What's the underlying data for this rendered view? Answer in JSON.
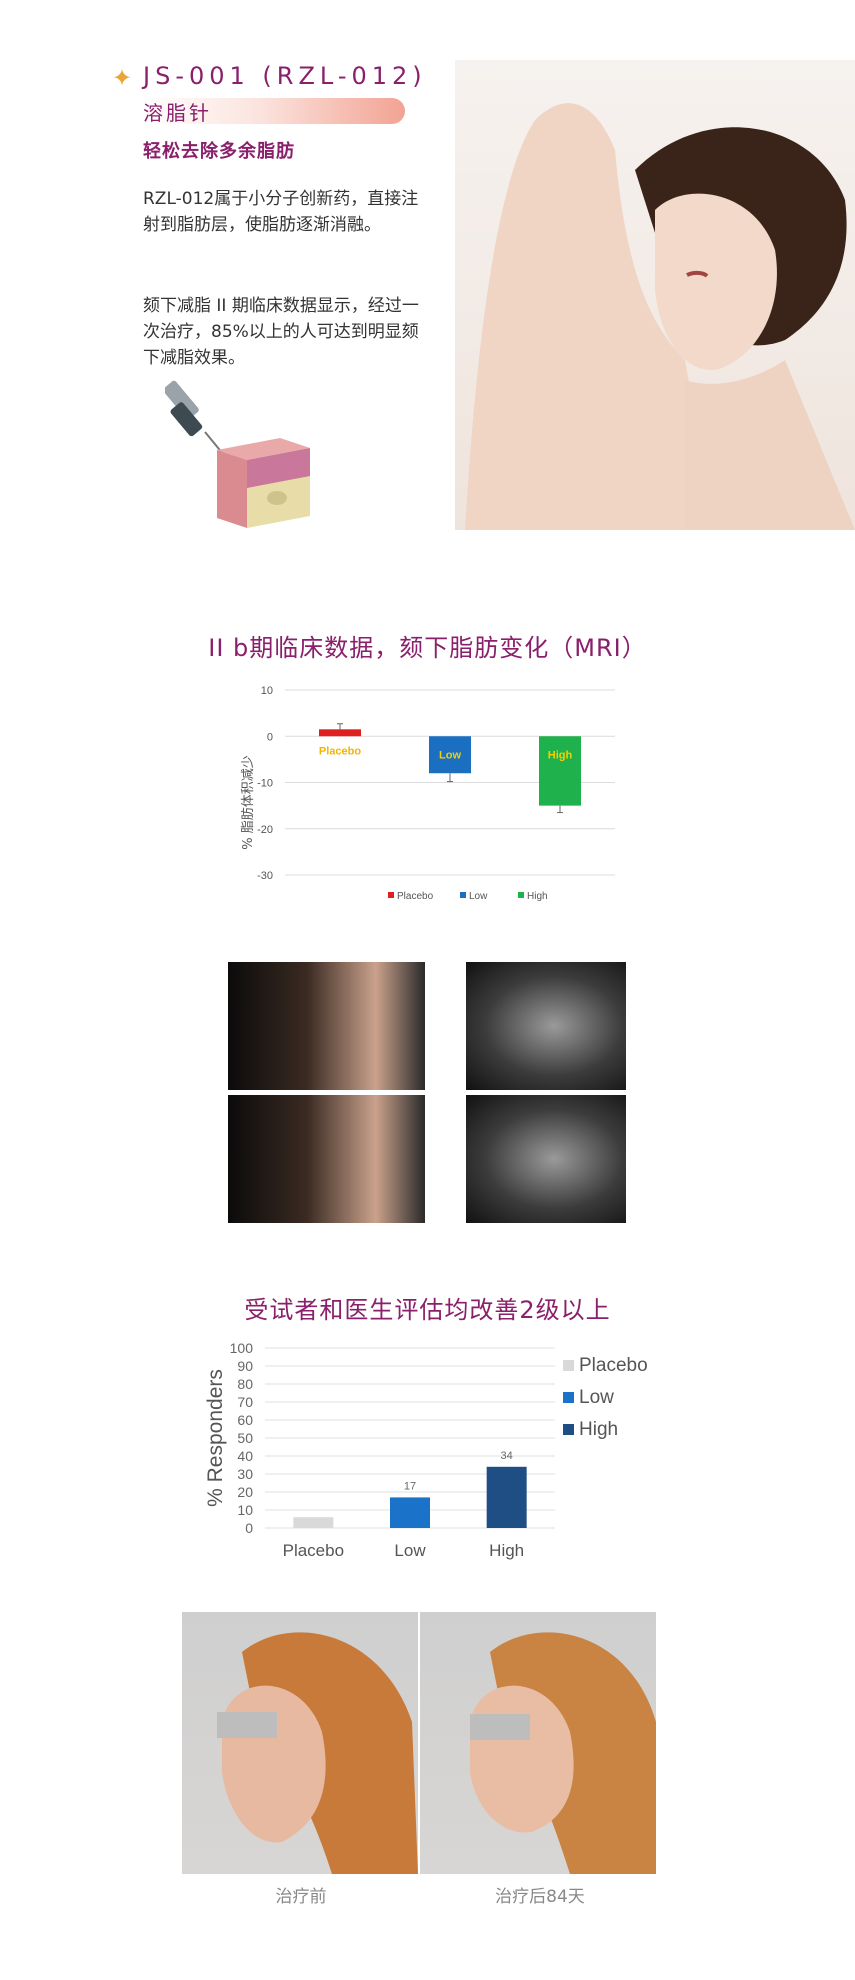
{
  "hero": {
    "star_glyph": "✦",
    "product_code": "JS-001 (RZL-012)",
    "product_name": "溶脂针",
    "subtitle": "轻松去除多余脂肪",
    "paragraph_1": "RZL-012属于小分子创新药，直接注射到脂肪层，使脂肪逐渐消融。",
    "paragraph_2": "颏下减脂 II 期临床数据显示，经过一次治疗，85%以上的人可达到明显颏下减脂效果。",
    "accent_color": "#8a1f6b",
    "star_color": "#e9a43a"
  },
  "mri_section": {
    "title": "II b期临床数据，颏下脂肪变化（MRI）"
  },
  "responders_section": {
    "title": "受试者和医生评估均改善2级以上"
  },
  "before_after": {
    "before_caption": "治疗前",
    "after_caption": "治疗后84天"
  },
  "chart_data": [
    {
      "type": "bar",
      "categories": [
        "Placebo",
        "Low",
        "High"
      ],
      "values": [
        1.5,
        -8,
        -15
      ],
      "error_bars": [
        1.2,
        1.8,
        1.5
      ],
      "bar_labels": [
        "Placebo",
        "Low",
        "High"
      ],
      "colors": [
        "#e02020",
        "#1a6fc0",
        "#1fb14b"
      ],
      "label_colors": [
        "#f5b400",
        "#f5d000",
        "#f5d000"
      ],
      "ylabel": "% 脂肪体积减少",
      "ylim": [
        -30,
        10
      ],
      "yticks": [
        10,
        0,
        -10,
        -20,
        -30
      ],
      "grid": true,
      "legend": [
        "Placebo",
        "Low",
        "High"
      ],
      "legend_position": "bottom"
    },
    {
      "type": "bar",
      "categories": [
        "Placebo",
        "Low",
        "High"
      ],
      "values": [
        6,
        17,
        34
      ],
      "data_labels": [
        "",
        "17",
        "34"
      ],
      "colors": [
        "#d9d9d9",
        "#1a73c8",
        "#1f4e84"
      ],
      "ylabel": "% Responders",
      "ylim": [
        0,
        100
      ],
      "yticks": [
        0,
        10,
        20,
        30,
        40,
        50,
        60,
        70,
        80,
        90,
        100
      ],
      "grid": true,
      "legend": [
        "Placebo",
        "Low",
        "High"
      ],
      "legend_position": "right"
    }
  ]
}
